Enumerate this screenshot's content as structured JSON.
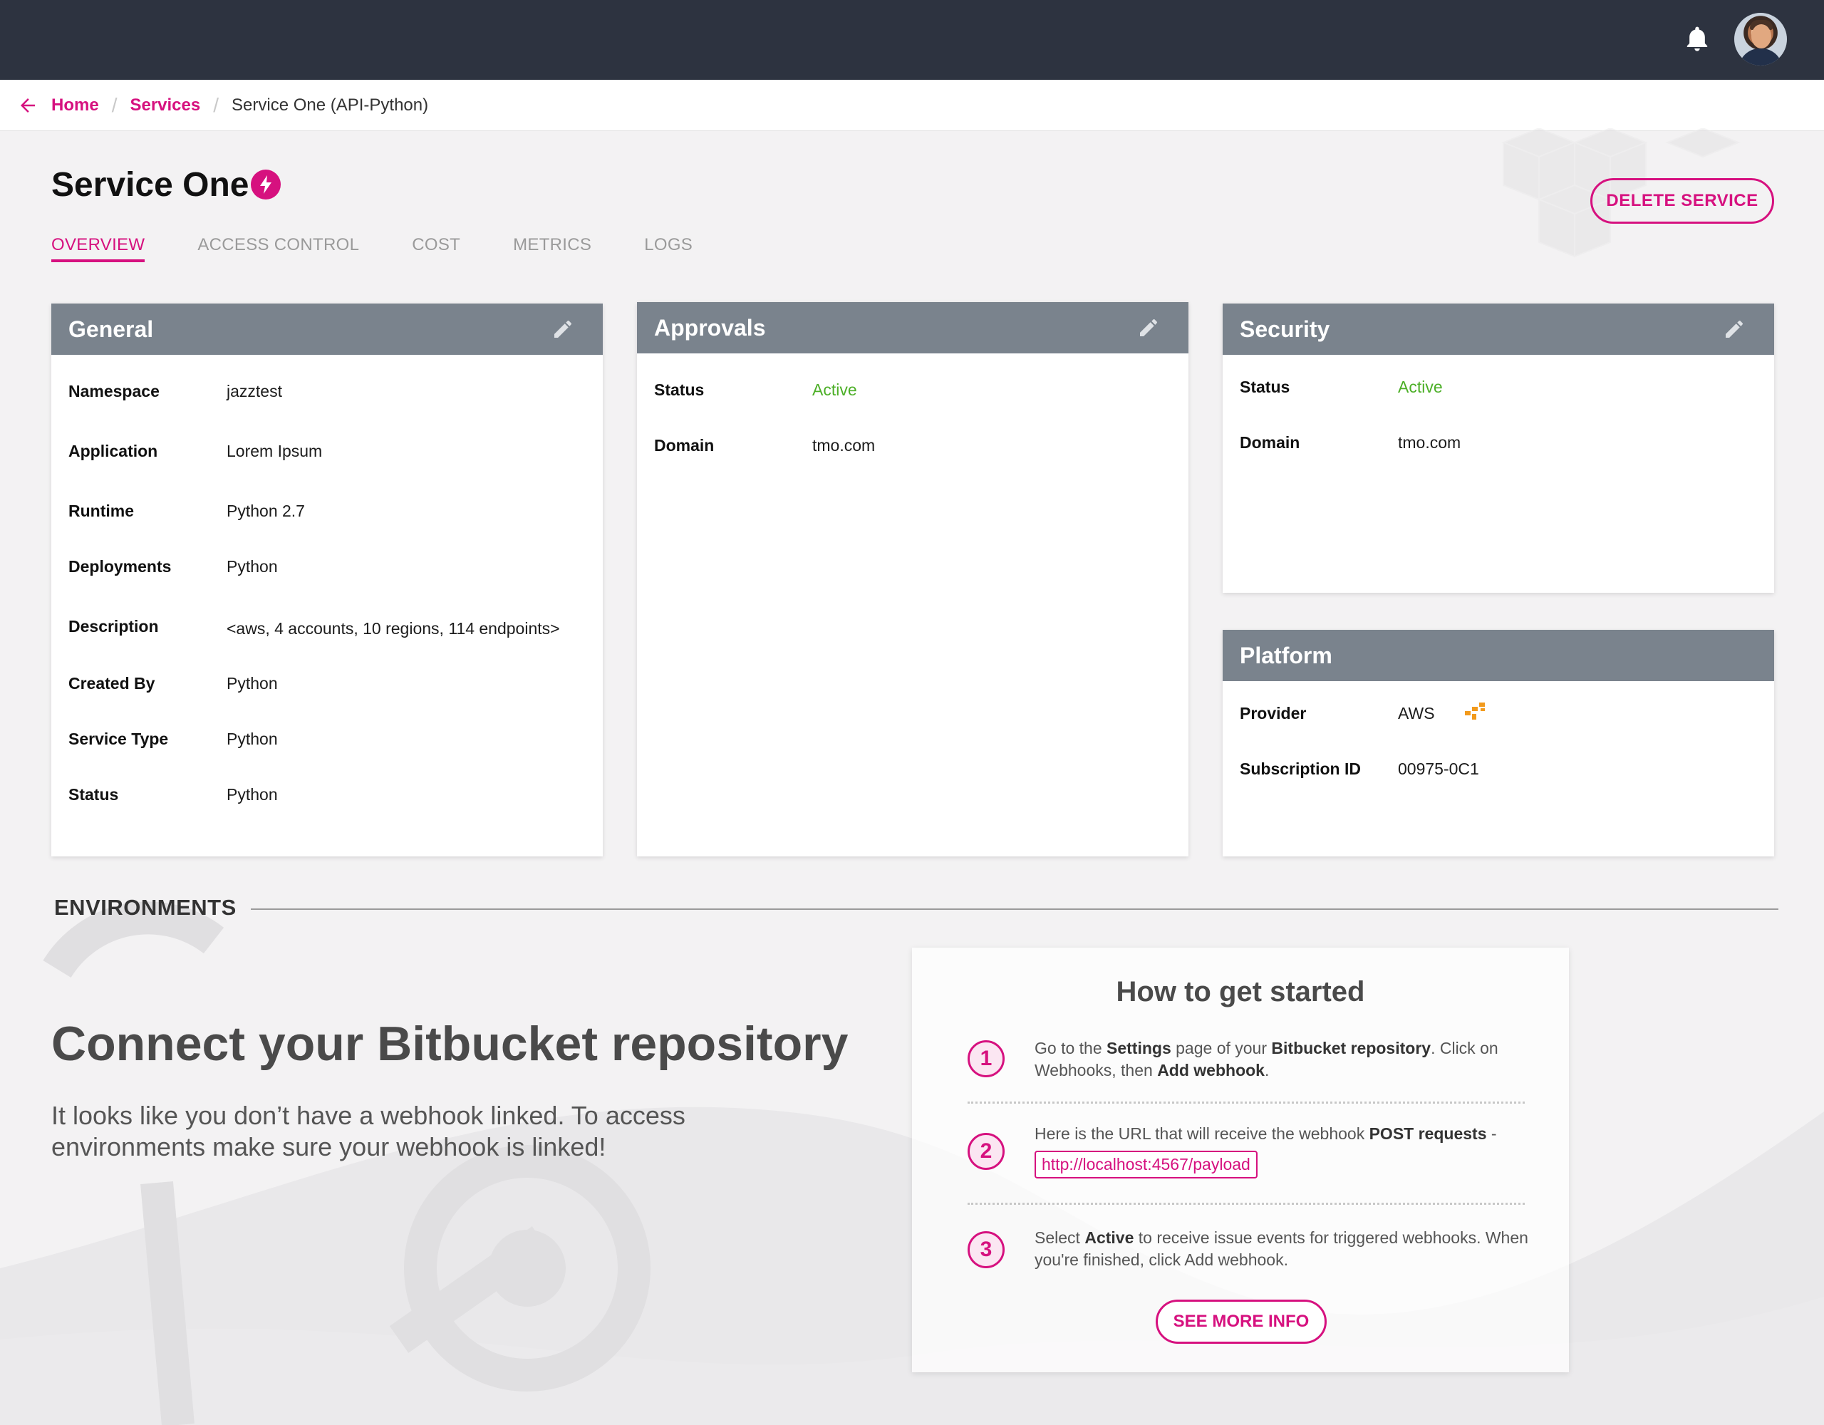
{
  "breadcrumb": {
    "home": "Home",
    "services": "Services",
    "current": "Service One (API-Python)"
  },
  "service": {
    "title": "Service One",
    "delete_label": "DELETE SERVICE"
  },
  "tabs": [
    "OVERVIEW",
    "ACCESS CONTROL",
    "COST",
    "METRICS",
    "LOGS"
  ],
  "general": {
    "title": "General",
    "rows": [
      {
        "label": "Namespace",
        "value": "jazztest"
      },
      {
        "label": "Application",
        "value": "Lorem Ipsum"
      },
      {
        "label": "Runtime",
        "value": "Python 2.7"
      },
      {
        "label": "Deployments",
        "value": "Python"
      },
      {
        "label": "Description",
        "value": "<aws, 4 accounts, 10 regions, 114 endpoints>"
      },
      {
        "label": "Created By",
        "value": "Python"
      },
      {
        "label": "Service Type",
        "value": "Python"
      },
      {
        "label": "Status",
        "value": "Python"
      }
    ]
  },
  "approvals": {
    "title": "Approvals",
    "rows": [
      {
        "label": "Status",
        "value": "Active"
      },
      {
        "label": "Domain",
        "value": "tmo.com"
      }
    ]
  },
  "security": {
    "title": "Security",
    "rows": [
      {
        "label": "Status",
        "value": "Active"
      },
      {
        "label": "Domain",
        "value": "tmo.com"
      }
    ]
  },
  "platform": {
    "title": "Platform",
    "rows": [
      {
        "label": "Provider",
        "value": "AWS"
      },
      {
        "label": "Subscription ID",
        "value": "00975-0C1"
      }
    ]
  },
  "environments": {
    "title": "ENVIRONMENTS",
    "connect_title": "Connect your Bitbucket repository",
    "connect_text": "It looks like you don’t have a webhook linked. To access environments make sure your webhook is linked!"
  },
  "howto": {
    "title": "How to get started",
    "steps": [
      {
        "num": "1",
        "t1": "Go to the ",
        "b1": "Settings",
        "t2": " page of your ",
        "b2": "Bitbucket repository",
        "t3": ". Click on Webhooks, then ",
        "b3": "Add webhook",
        "t4": "."
      },
      {
        "num": "2",
        "t1": "Here is the URL that will receive the webhook ",
        "b1": "POST requests",
        "t2": " -",
        "url": "http://localhost:4567/payload"
      },
      {
        "num": "3",
        "t1": "Select ",
        "b1": "Active",
        "t2": " to receive issue events for triggered webhooks. When you're finished, click Add webhook."
      }
    ],
    "more_label": "SEE MORE INFO"
  },
  "icons": {
    "back": "arrow-left-icon",
    "bell": "bell-icon",
    "bolt": "lightning-bolt-icon",
    "edit": "pencil-icon",
    "aws": "aws-logo-icon"
  },
  "colors": {
    "accent": "#d6117f",
    "topbar": "#2d3340",
    "card_header": "#7a838d",
    "active": "#4caf27"
  }
}
